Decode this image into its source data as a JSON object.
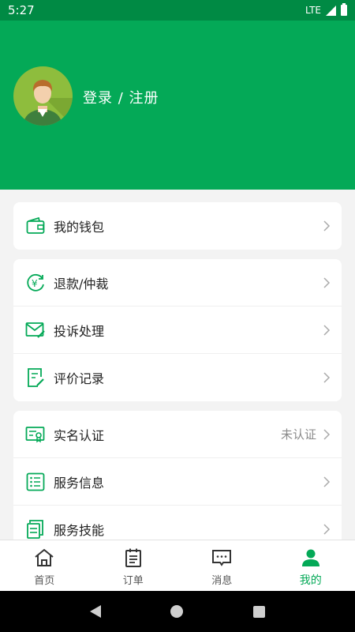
{
  "status_bar": {
    "time": "5:27",
    "network": "LTE"
  },
  "profile": {
    "login_text": "登录 / 注册"
  },
  "menu": {
    "wallet": {
      "label": "我的钱包"
    },
    "refund": {
      "label": "退款/仲裁"
    },
    "complaint": {
      "label": "投诉处理"
    },
    "review": {
      "label": "评价记录"
    },
    "realname": {
      "label": "实名认证",
      "value": "未认证"
    },
    "service_info": {
      "label": "服务信息"
    },
    "service_skill": {
      "label": "服务技能"
    }
  },
  "tabs": [
    {
      "label": "首页",
      "icon": "home-icon"
    },
    {
      "label": "订单",
      "icon": "order-icon"
    },
    {
      "label": "消息",
      "icon": "message-icon"
    },
    {
      "label": "我的",
      "icon": "person-icon",
      "active": true
    }
  ],
  "colors": {
    "brand": "#04a957",
    "status_bar": "#008a44"
  }
}
